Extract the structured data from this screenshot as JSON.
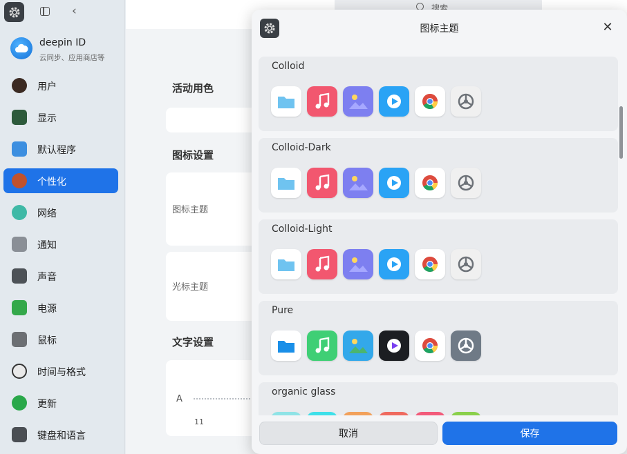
{
  "sidebar": {
    "account": {
      "title": "deepin ID",
      "subtitle": "云同步、应用商店等"
    },
    "items": [
      {
        "label": "用户",
        "icon": "user-icon",
        "color": "#3b2a22",
        "active": false
      },
      {
        "label": "显示",
        "icon": "display-icon",
        "color": "#2d5a3b",
        "active": false
      },
      {
        "label": "默认程序",
        "icon": "default-apps-icon",
        "color": "#3d8fe0",
        "active": false
      },
      {
        "label": "个性化",
        "icon": "personalization-icon",
        "color": "#c0522e",
        "active": true
      },
      {
        "label": "网络",
        "icon": "network-icon",
        "color": "#3fb9a6",
        "active": false
      },
      {
        "label": "通知",
        "icon": "notification-bell-icon",
        "color": "#8a8f96",
        "active": false
      },
      {
        "label": "声音",
        "icon": "speaker-icon",
        "color": "#4d5257",
        "active": false
      },
      {
        "label": "电源",
        "icon": "battery-icon",
        "color": "#34a84a",
        "active": false
      },
      {
        "label": "鼠标",
        "icon": "mouse-icon",
        "color": "#6c6f73",
        "active": false
      },
      {
        "label": "时间与格式",
        "icon": "clock-icon",
        "color": "#e9e9e9",
        "active": false
      },
      {
        "label": "更新",
        "icon": "update-icon",
        "color": "#2aa84a",
        "active": false
      },
      {
        "label": "键盘和语言",
        "icon": "keyboard-icon",
        "color": "#4a4e53",
        "active": false
      }
    ]
  },
  "main": {
    "search_text": "搜索",
    "section_active_color": "活动用色",
    "section_icon_settings": "图标设置",
    "label_icon_theme": "图标主题",
    "label_cursor_theme": "光标主题",
    "section_font_settings": "文字设置",
    "font_size_letter": "A",
    "font_size_value": "11"
  },
  "dialog": {
    "title": "图标主题",
    "themes": [
      {
        "name": "Colloid"
      },
      {
        "name": "Colloid-Dark"
      },
      {
        "name": "Colloid-Light"
      },
      {
        "name": "Pure"
      },
      {
        "name": "organic glass"
      }
    ],
    "cancel_label": "取消",
    "save_label": "保存"
  },
  "colors": {
    "accent": "#1f73e8",
    "sidebar_bg": "#e3e9ee",
    "dialog_bg": "#f4f5f7"
  }
}
